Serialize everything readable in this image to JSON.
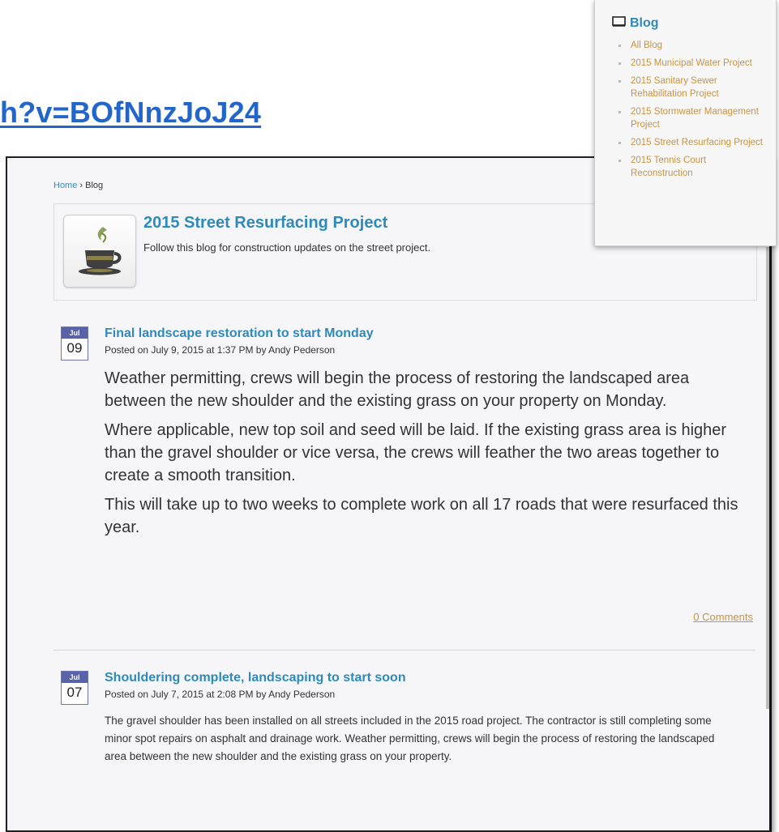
{
  "url_fragment": "h?v=BOfNnzJoJ24",
  "breadcrumb": {
    "home": "Home",
    "sep": "›",
    "current": "Blog"
  },
  "blog": {
    "title": "2015 Street Resurfacing Project",
    "description": "Follow this blog for construction updates on the street project.",
    "icon": "coffee-cup-icon"
  },
  "posts": [
    {
      "month": "Jul",
      "day": "09",
      "title": "Final landscape restoration to start Monday",
      "meta": "Posted on July 9, 2015 at 1:37 PM by Andy Pederson",
      "paragraphs": [
        "Weather permitting, crews will begin the process of restoring the landscaped area between the new shoulder and the existing grass on your property on Monday.",
        "Where applicable, new top soil and seed will be laid.  If the existing grass area is higher than the gravel shoulder or vice versa, the crews will feather the two areas together to create a smooth transition.",
        "This will take up to two weeks to complete work on all 17 roads that were resurfaced this year."
      ],
      "comments": "0 Comments"
    },
    {
      "month": "Jul",
      "day": "07",
      "title": "Shouldering complete, landscaping to start soon",
      "meta": "Posted on July 7, 2015 at 2:08 PM by Andy Pederson",
      "body": "The gravel shoulder has been installed on all streets included in the 2015 road project.  The contractor is still completing some minor spot repairs on asphalt and drainage work.  Weather permitting, crews will begin the process of restoring the landscaped area between the new shoulder and the existing grass on your property."
    }
  ],
  "sidebar": {
    "heading": "Blog",
    "icon": "book-icon",
    "items": [
      "All Blog",
      "2015 Municipal Water Project",
      "2015 Sanitary Sewer Rehabilitation Project",
      "2015 Stormwater Management Project",
      "2015 Street Resurfacing Project",
      "2015 Tennis Court Reconstruction"
    ]
  },
  "colors": {
    "link_blue": "#2f8ab8",
    "url_blue": "#2266cc",
    "accent_orange": "#c89343",
    "badge_purple": "#5a62a8"
  }
}
